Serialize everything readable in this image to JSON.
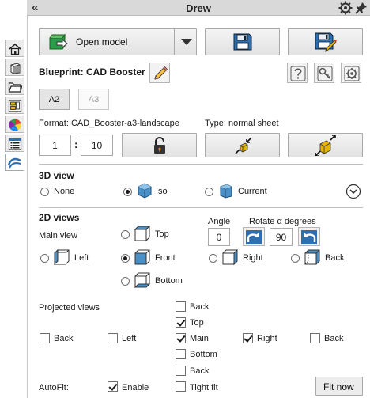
{
  "window": {
    "title": "Drew",
    "collapse_glyph": "«"
  },
  "sidebar": {
    "tabs": [
      {
        "icon": "home-icon"
      },
      {
        "icon": "cube-stack-icon"
      },
      {
        "icon": "folder-icon"
      },
      {
        "icon": "drawing-icon"
      },
      {
        "icon": "color-wheel-icon"
      },
      {
        "icon": "list-icon"
      },
      {
        "icon": "wave-icon"
      }
    ]
  },
  "toolbar": {
    "open_model_label": "Open model"
  },
  "blueprint": {
    "label": "Blueprint: CAD Booster"
  },
  "paper": {
    "size_a2": "A2",
    "size_a3": "A3",
    "format_label": "Format: CAD_Booster-a3-landscape",
    "type_label": "Type: normal sheet",
    "scale_num": "1",
    "scale_sep": ":",
    "scale_den": "10"
  },
  "view3d": {
    "heading": "3D view",
    "options": [
      "None",
      "Iso",
      "Current"
    ],
    "selected": "Iso"
  },
  "views2d": {
    "heading": "2D views",
    "main_view_label": "Main view",
    "options": {
      "top": "Top",
      "left": "Left",
      "front": "Front",
      "right": "Right",
      "back": "Back",
      "bottom": "Bottom"
    },
    "selected": "Front",
    "angle_label": "Angle",
    "angle_value": "0",
    "rotate_label": "Rotate α degrees",
    "rotate_value": "90"
  },
  "projected": {
    "heading": "Projected views",
    "items": {
      "back_top": {
        "label": "Back",
        "checked": false
      },
      "top": {
        "label": "Top",
        "checked": true
      },
      "back_left": {
        "label": "Back",
        "checked": false
      },
      "left": {
        "label": "Left",
        "checked": false
      },
      "main": {
        "label": "Main",
        "checked": true
      },
      "right": {
        "label": "Right",
        "checked": true
      },
      "back_right": {
        "label": "Back",
        "checked": false
      },
      "bottom": {
        "label": "Bottom",
        "checked": false
      },
      "back_bottom": {
        "label": "Back",
        "checked": false
      }
    }
  },
  "autofit": {
    "label": "AutoFit:",
    "enable_label": "Enable",
    "enable_checked": true,
    "tight_label": "Tight fit",
    "tight_checked": false,
    "fit_now_label": "Fit now"
  },
  "colors": {
    "accent_blue": "#2f6fb0",
    "icon_yellow": "#e8b400",
    "lock_orange": "#e08a00"
  }
}
